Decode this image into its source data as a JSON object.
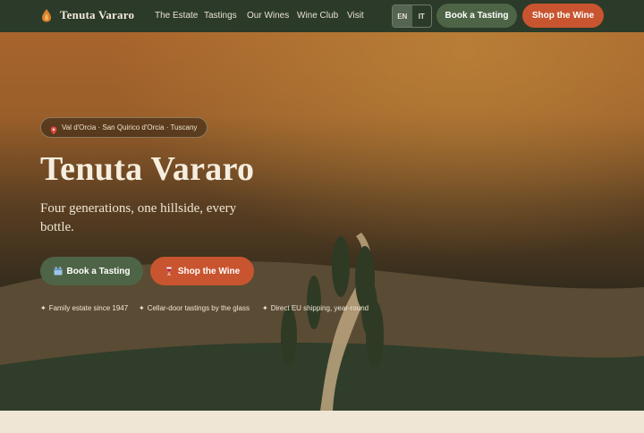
{
  "nav": {
    "brand": "Tenuta Vararo",
    "brand_icon": "flame-drop-icon",
    "links": [
      "The Estate",
      "Tastings",
      "Our Wines",
      "Wine Club",
      "Visit"
    ],
    "lang": {
      "en": "EN",
      "it": "IT",
      "active": "EN"
    },
    "book_label": "Book a Tasting",
    "shop_label": "Shop the Wine"
  },
  "hero": {
    "location": "Val d'Orcia · San Quirico d'Orcia · Tuscany",
    "location_icon": "map-pin-icon",
    "title": "Tenuta Vararo",
    "subtitle": "Four generations, one hillside, every bottle.",
    "book_label": "Book a Tasting",
    "book_icon": "calendar-icon",
    "shop_label": "Shop the Wine",
    "shop_icon": "wine-glass-icon",
    "features": [
      "Family estate since 1947",
      "Cellar-door tastings by the glass",
      "Direct EU shipping, year-round"
    ]
  },
  "colors": {
    "nav_bg": "#2c3a2a",
    "accent_green": "#4e6446",
    "accent_orange": "#c8552f",
    "cream": "#efe6d6"
  }
}
